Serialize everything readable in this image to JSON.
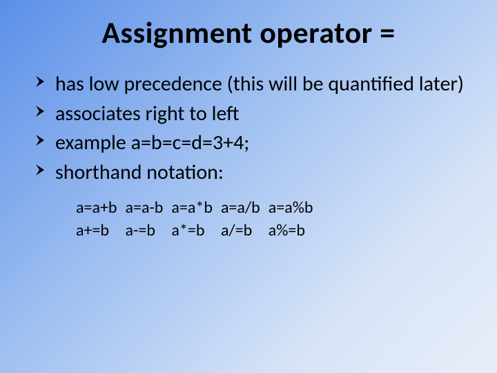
{
  "title": "Assignment operator =",
  "bullets": [
    "has low precedence (this will be quantified later)",
    "associates right to left",
    "example a=b=c=d=3+4;",
    "shorthand notation:"
  ],
  "shorthand_table": {
    "row1": [
      "a=a+b",
      "a=a-b",
      "a=a*b",
      "a=a/b",
      "a=a%b"
    ],
    "row2": [
      "a+=b",
      "a-=b",
      "a*=b",
      "a/=b",
      "a%=b"
    ]
  }
}
